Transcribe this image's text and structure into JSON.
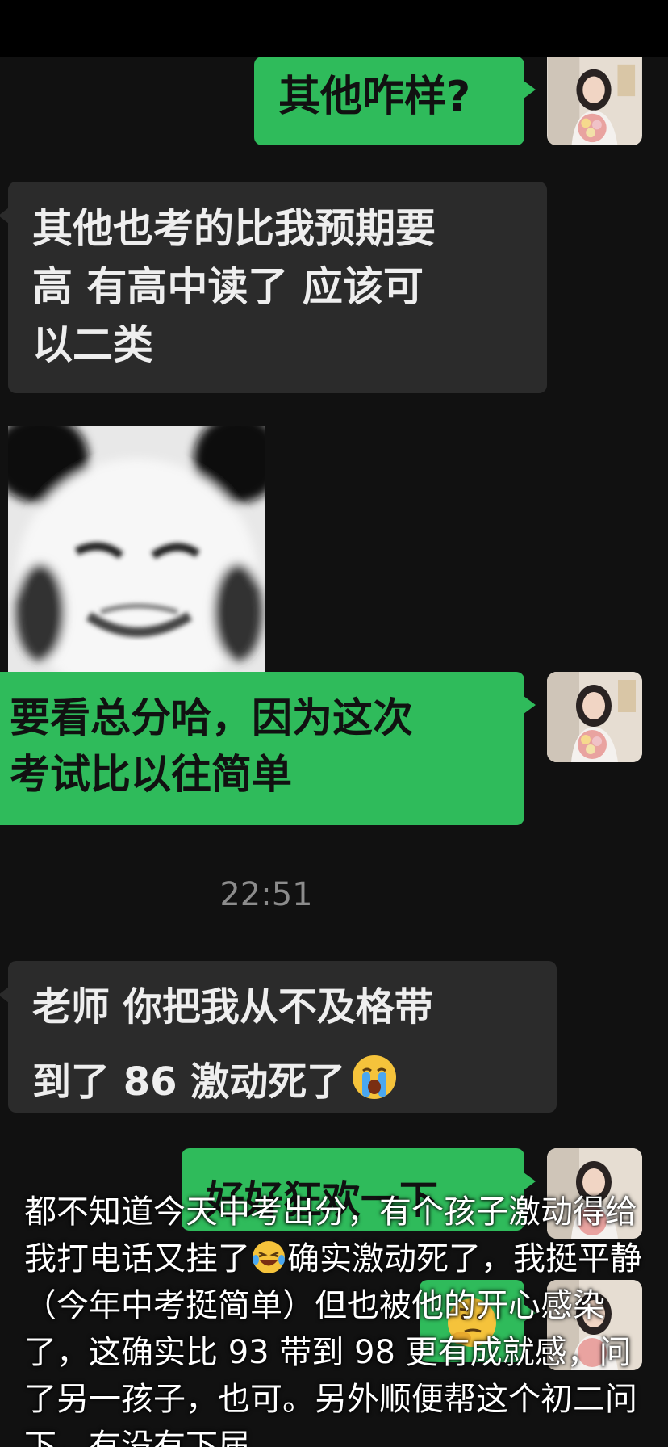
{
  "messages": {
    "m1": "其他咋样?",
    "m2": "其他也考的比我预期要\n高 有高中读了 应该可\n以二类",
    "m3": "要看总分哈，因为这次\n考试比以往简单",
    "time": "22:51",
    "m4_line1": "老师 你把我从不及格带",
    "m4_line2": "到了 86 激动死了",
    "m5": "好好狂欢一下"
  },
  "caption": {
    "part1": "都不知道今天中考出分，有个孩子激动得给我打电话又挂了",
    "part2": "确实激动死了，我挺平静（今年中考挺简单）但也被他的开心感染了，这确实比 93 带到 98 更有成就感，问了另一孩子，也可。另外顺便帮这个初二问下，有没有下届..."
  },
  "icons": {
    "avatar": "avatar-woman-flowers",
    "sticker": "panda-face-sticker",
    "emoji1": "crying-face-emoji",
    "emoji2": "thinking-face-emoji",
    "emoji3": "laughing-tears-emoji"
  },
  "colors": {
    "sent_bubble": "#2fbb5b",
    "received_bubble": "#2b2b2b",
    "background": "#111111"
  }
}
